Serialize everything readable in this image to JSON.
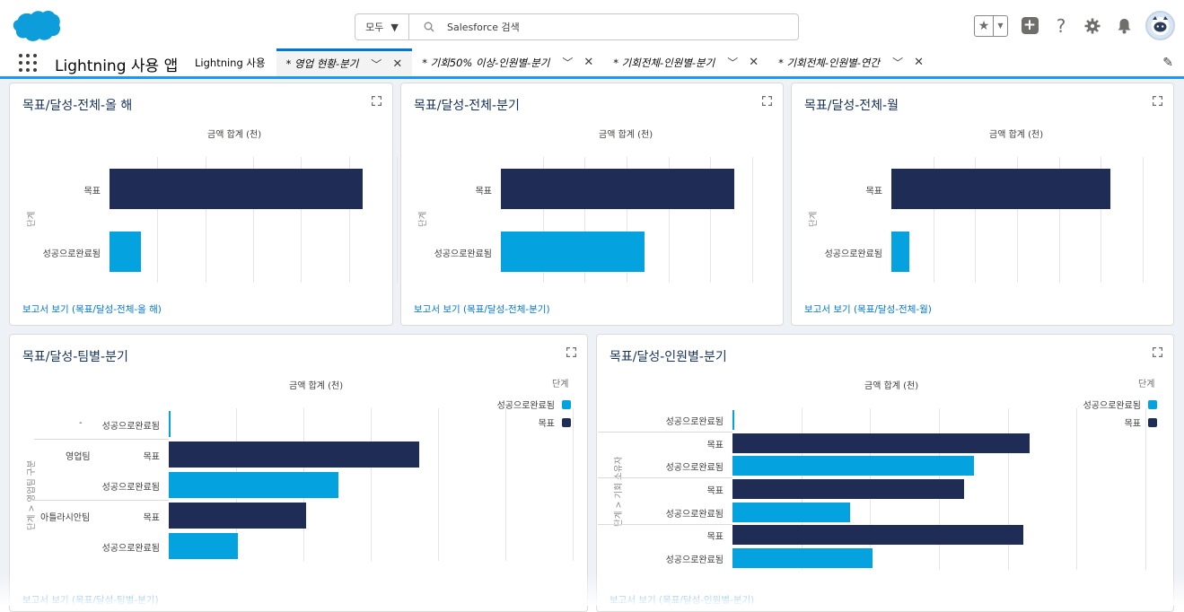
{
  "colors": {
    "target": "#1e2c56",
    "achieved": "#04a3e0",
    "brand_blue": "#0176d3"
  },
  "header": {
    "scope_label": "모두",
    "search_placeholder": "Salesforce 검색",
    "icons": [
      "salesforce-logo-icon",
      "star-icon",
      "plus-icon",
      "help-icon",
      "gear-icon",
      "bell-icon",
      "avatar"
    ]
  },
  "nav": {
    "app_name": "Lightning 사용 앱",
    "tabs": [
      {
        "label": "Lightning 사용",
        "closable": false
      },
      {
        "label": "* 영업 현황-분기",
        "closable": true,
        "active": true
      },
      {
        "label": "* 기회50% 이상-인원별-분기",
        "closable": true
      },
      {
        "label": "* 기회전체-인원별-분기",
        "closable": true
      },
      {
        "label": "* 기회전체-인원별-연간",
        "closable": true
      }
    ]
  },
  "cards": [
    {
      "title": "목표/달성-전체-올 해",
      "x_title": "금액 합계 (천)",
      "y_title": "단계",
      "link": "보고서 보기 (목표/달성-전체-올 해)"
    },
    {
      "title": "목표/달성-전체-분기",
      "x_title": "금액 합계 (천)",
      "y_title": "단계",
      "link": "보고서 보기 (목표/달성-전체-분기)"
    },
    {
      "title": "목표/달성-전체-월",
      "x_title": "금액 합계 (천)",
      "y_title": "단계",
      "link": "보고서 보기 (목표/달성-전체-월)"
    },
    {
      "title": "목표/달성-팀별-분기",
      "x_title": "금액 합계 (천)",
      "y_title": "단계 > 영업팀 구분",
      "legend_title": "단계",
      "link": "보고서 보기 (목표/달성-팀별-분기)"
    },
    {
      "title": "목표/달성-인원별-분기",
      "x_title": "금액 합계 (천)",
      "y_title": "단계 > 기회 소유자",
      "legend_title": "단계",
      "link": "보고서 보기 (목표/달성-인원별-분기)"
    }
  ],
  "chart_data": [
    {
      "type": "bar",
      "orientation": "horizontal",
      "title": "목표/달성-전체-올 해",
      "xlabel": "금액 합계 (천)",
      "ylabel": "단계",
      "xlim": [
        0,
        1
      ],
      "categories": [
        "목표",
        "성공으로완료됨"
      ],
      "values": [
        0.88,
        0.11
      ],
      "grid": true
    },
    {
      "type": "bar",
      "orientation": "horizontal",
      "title": "목표/달성-전체-분기",
      "xlabel": "금액 합계 (천)",
      "ylabel": "단계",
      "xlim": [
        0,
        1
      ],
      "categories": [
        "목표",
        "성공으로완료됨"
      ],
      "values": [
        0.93,
        0.57
      ],
      "grid": true
    },
    {
      "type": "bar",
      "orientation": "horizontal",
      "title": "목표/달성-전체-월",
      "xlabel": "금액 합계 (천)",
      "ylabel": "단계",
      "xlim": [
        0,
        1
      ],
      "categories": [
        "목표",
        "성공으로완료됨"
      ],
      "values": [
        0.87,
        0.07
      ],
      "grid": true
    },
    {
      "type": "bar",
      "orientation": "horizontal",
      "title": "목표/달성-팀별-분기",
      "xlabel": "금액 합계 (천)",
      "ylabel": "단계 > 영업팀 구분",
      "xlim": [
        0,
        1
      ],
      "legend_title": "단계",
      "legend_placement": "top-right",
      "grid": true,
      "series_names": [
        "성공으로완료됨",
        "목표"
      ],
      "rows": [
        {
          "group": "-",
          "stage": "성공으로완료됨",
          "value": 0.005
        },
        {
          "group": "영업팀",
          "stage": "목표",
          "value": 0.62
        },
        {
          "group": "",
          "stage": "성공으로완료됨",
          "value": 0.42
        },
        {
          "group": "아틀라시안팀",
          "stage": "목표",
          "value": 0.34
        },
        {
          "group": "",
          "stage": "성공으로완료됨",
          "value": 0.17
        }
      ]
    },
    {
      "type": "bar",
      "orientation": "horizontal",
      "title": "목표/달성-인원별-분기",
      "xlabel": "금액 합계 (천)",
      "ylabel": "단계 > 기회 소유자",
      "xlim": [
        0,
        1
      ],
      "legend_title": "단계",
      "legend_placement": "top-right",
      "grid": true,
      "series_names": [
        "성공으로완료됨",
        "목표"
      ],
      "rows": [
        {
          "stage": "성공으로완료됨",
          "value": 0.005
        },
        {
          "stage": "목표",
          "value": 0.72
        },
        {
          "stage": "성공으로완료됨",
          "value": 0.585
        },
        {
          "stage": "목표",
          "value": 0.56
        },
        {
          "stage": "성공으로완료됨",
          "value": 0.285
        },
        {
          "stage": "목표",
          "value": 0.705
        },
        {
          "stage": "성공으로완료됨",
          "value": 0.34
        }
      ]
    }
  ]
}
